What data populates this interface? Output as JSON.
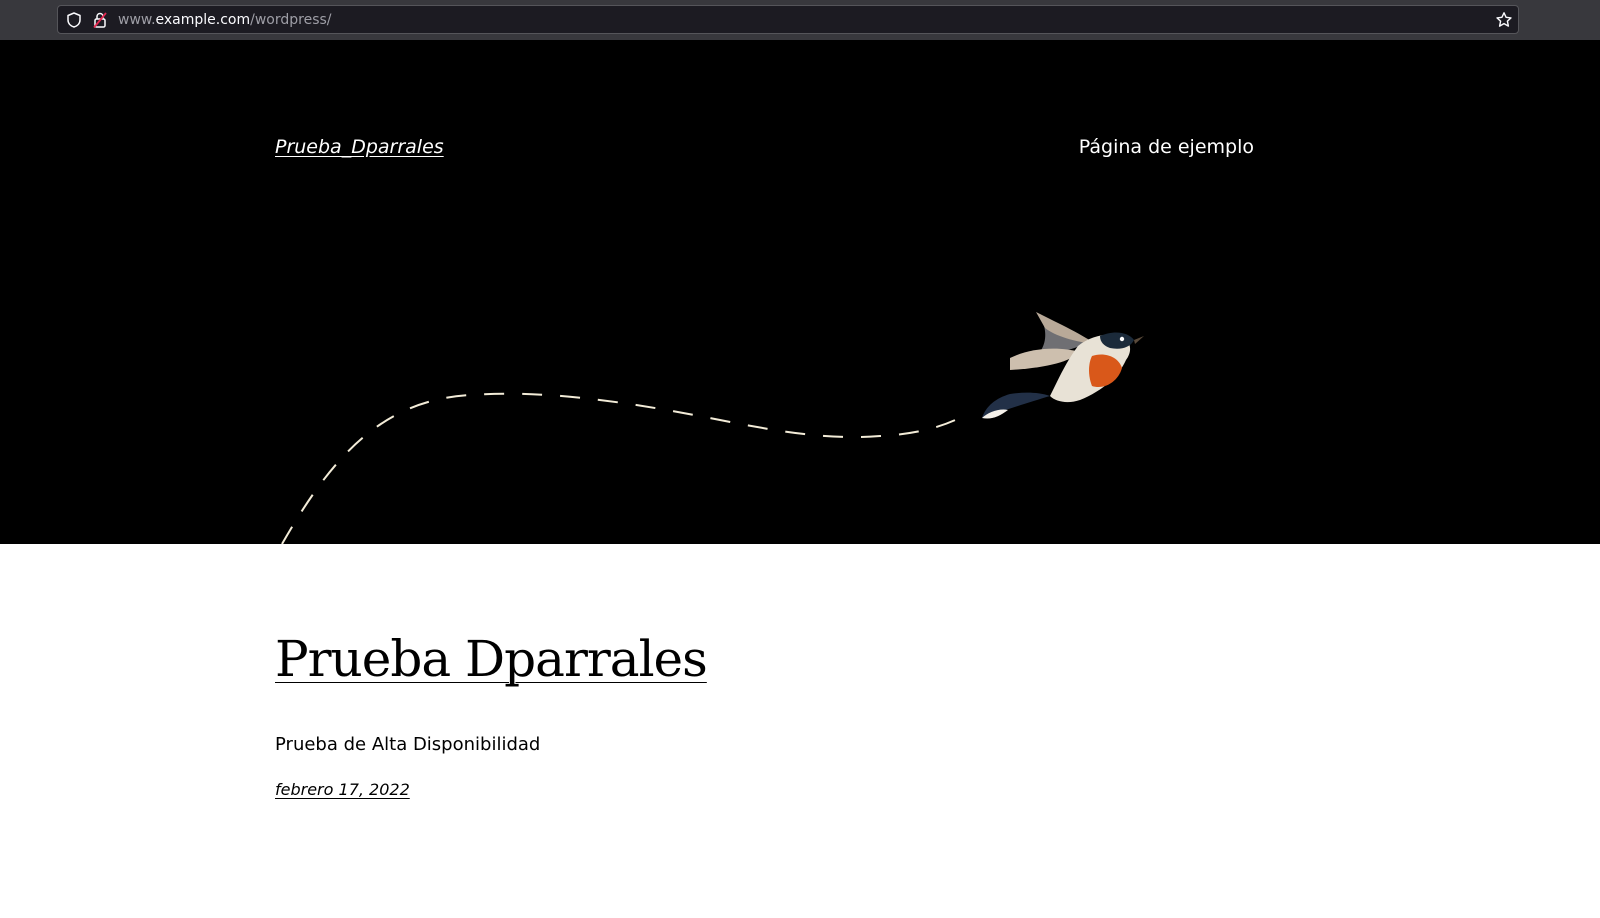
{
  "browser": {
    "url_prefix": "www.",
    "url_host": "example.com",
    "url_path": "/wordpress/",
    "icons": [
      "shield-icon",
      "lock-icon",
      "star-icon"
    ]
  },
  "header": {
    "site_title": "Prueba_Dparrales",
    "nav_link": "Página de ejemplo",
    "background_color": "#000000"
  },
  "post": {
    "title": "Prueba Dparrales",
    "excerpt": "Prueba de Alta Disponibilidad",
    "date": "febrero 17, 2022"
  }
}
